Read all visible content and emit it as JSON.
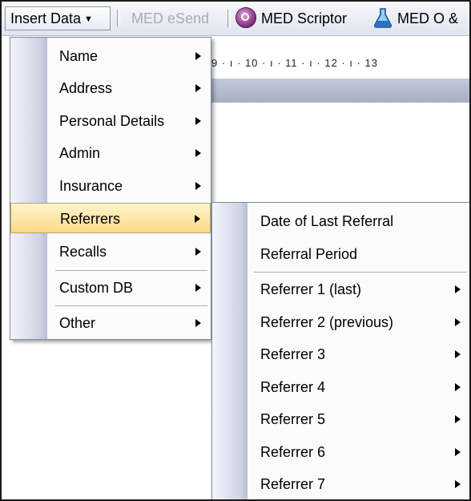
{
  "toolbar": {
    "insert_data_label": "Insert Data",
    "med_esend_label": "MED eSend",
    "med_scriptor_label": "MED Scriptor",
    "med_o_label": "MED O &",
    "caret_icon": "chevron-down-icon",
    "scriptor_icon": "scriptor-circle-icon",
    "med_o_icon": "flask-icon"
  },
  "ruler": {
    "ticks_text": "9 · ı · 10 · ı · 11 · ı · 12 · ı · 13"
  },
  "insert_menu": {
    "items": [
      {
        "label": "Name",
        "has_submenu": true
      },
      {
        "label": "Address",
        "has_submenu": true
      },
      {
        "label": "Personal Details",
        "has_submenu": true
      },
      {
        "label": "Admin",
        "has_submenu": true
      },
      {
        "label": "Insurance",
        "has_submenu": true
      },
      {
        "label": "Referrers",
        "has_submenu": true,
        "highlighted": true
      },
      {
        "label": "Recalls",
        "has_submenu": true
      },
      {
        "label": "Custom DB",
        "has_submenu": true
      },
      {
        "label": "Other",
        "has_submenu": true
      }
    ]
  },
  "referrers_menu": {
    "items": [
      {
        "label": "Date of Last Referral",
        "has_submenu": false
      },
      {
        "label": "Referral Period",
        "has_submenu": false
      },
      {
        "label": "Referrer 1 (last)",
        "has_submenu": true
      },
      {
        "label": "Referrer 2 (previous)",
        "has_submenu": true
      },
      {
        "label": "Referrer 3",
        "has_submenu": true
      },
      {
        "label": "Referrer 4",
        "has_submenu": true
      },
      {
        "label": "Referrer 5",
        "has_submenu": true
      },
      {
        "label": "Referrer 6",
        "has_submenu": true
      },
      {
        "label": "Referrer 7",
        "has_submenu": true
      }
    ]
  },
  "colors": {
    "highlight": "#ffd98a",
    "menu_strip": "#cfd3e4",
    "disabled_text": "#a7acb5"
  }
}
